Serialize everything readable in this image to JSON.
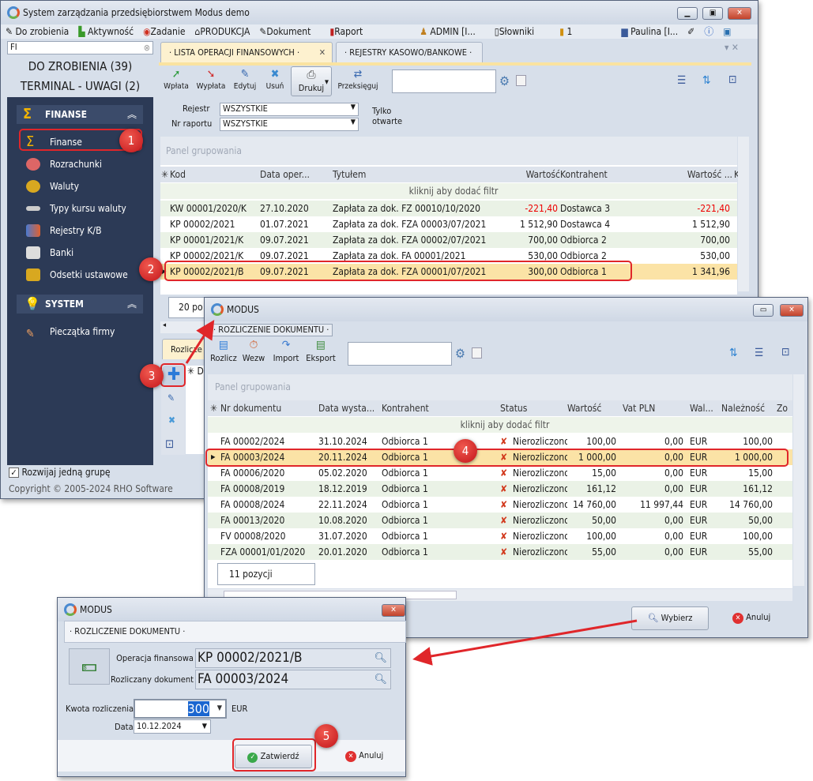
{
  "main_window": {
    "title": "System zarządzania przedsiębiorstwem Modus demo",
    "menu": [
      "Do zrobienia",
      "Aktywność",
      "Zadanie",
      "PRODUKCJA",
      "Dokument",
      "Raport",
      "ADMIN [I...",
      "Słowniki",
      "1",
      "Paulina [I..."
    ],
    "search_value": "FI",
    "counters": [
      "DO ZROBIENIA (39)",
      "TERMINAL - UWAGI (2)"
    ],
    "groups": [
      {
        "label": "FINANSE",
        "items": [
          "Finanse",
          "Rozrachunki",
          "Waluty",
          "Typy kursu waluty",
          "Rejestry K/B",
          "Banki",
          "Odsetki ustawowe"
        ]
      },
      {
        "label": "SYSTEM",
        "items": [
          "Pieczątka firmy"
        ]
      }
    ],
    "expand_one_group": "Rozwijaj jedną grupę",
    "expand_one_group_checked": true,
    "copyright": "Copyright © 2005-2024 RHO Software",
    "tabs": [
      "· LISTA OPERACJI FINANSOWYCH ·",
      "· REJESTRY KASOWO/BANKOWE ·"
    ],
    "toolbar": [
      "Wpłata",
      "Wypłata",
      "Edytuj",
      "Usuń",
      "Drukuj",
      "Przeksięguj"
    ],
    "filters": {
      "rejestr_label": "Rejestr",
      "rejestr_value": "WSZYSTKIE",
      "nr_raportu_label": "Nr raportu",
      "nr_raportu_value": "WSZYSTKIE",
      "only_open": "Tylko otwarte"
    },
    "group_panel": "Panel grupowania",
    "filter_hint": "kliknij aby dodać filtr",
    "columns": [
      "Kod",
      "Data oper...",
      "Tytułem",
      "Wartość",
      "Kontrahent",
      "Wartość ...",
      "K"
    ],
    "rows": [
      [
        "KW 00001/2020/K",
        "27.10.2020",
        "Zapłata za dok. FZ 00010/10/2020",
        "-221,40",
        "Dostawca 3",
        "-221,40"
      ],
      [
        "KP 00002/2021",
        "01.07.2021",
        "Zapłata za dok. FZA 00003/07/2021",
        "1 512,90",
        "Dostawca 4",
        "1 512,90"
      ],
      [
        "KP 00001/2021/K",
        "09.07.2021",
        "Zapłata za dok. FZA 00002/07/2021",
        "700,00",
        "Odbiorca 2",
        "700,00"
      ],
      [
        "KP 00002/2021/K",
        "09.07.2021",
        "Zapłata za dok. FA 00001/2021",
        "530,00",
        "Odbiorca 2",
        "530,00"
      ],
      [
        "KP 00002/2021/B",
        "09.07.2021",
        "Zapłata za dok. FZA 00001/07/2021",
        "300,00",
        "Odbiorca 1",
        "1 341,96"
      ]
    ],
    "count": "20 po",
    "lower_tab": "Rozlicze",
    "lower_col": "D"
  },
  "dialog_select": {
    "title": "MODUS",
    "tab": "· ROZLICZENIE DOKUMENTU ·",
    "toolbar": [
      "Rozlicz",
      "Wezw",
      "Import",
      "Eksport"
    ],
    "group_panel": "Panel grupowania",
    "filter_hint": "kliknij aby dodać filtr",
    "columns": [
      "Nr dokumentu",
      "Data wysta...",
      "Kontrahent",
      "Status",
      "Wartość",
      "Vat PLN",
      "Wal...",
      "Należność",
      "Zo"
    ],
    "rows": [
      [
        "FA 00002/2024",
        "31.10.2024",
        "Odbiorca 1",
        "Nierozliczono",
        "100,00",
        "0,00",
        "EUR",
        "100,00"
      ],
      [
        "FA 00003/2024",
        "20.11.2024",
        "Odbiorca 1",
        "Nierozliczono",
        "1 000,00",
        "0,00",
        "EUR",
        "1 000,00"
      ],
      [
        "FA 00006/2020",
        "05.02.2020",
        "Odbiorca 1",
        "Nierozliczono",
        "15,00",
        "0,00",
        "EUR",
        "15,00"
      ],
      [
        "FA 00008/2019",
        "18.12.2019",
        "Odbiorca 1",
        "Nierozliczono",
        "161,12",
        "0,00",
        "EUR",
        "161,12"
      ],
      [
        "FA 00008/2024",
        "22.11.2024",
        "Odbiorca 1",
        "Nierozliczono",
        "14 760,00",
        "11 997,44",
        "EUR",
        "14 760,00"
      ],
      [
        "FA 00013/2020",
        "10.08.2020",
        "Odbiorca 1",
        "Nierozliczono",
        "50,00",
        "0,00",
        "EUR",
        "50,00"
      ],
      [
        "FV 00008/2020",
        "31.07.2020",
        "Odbiorca 1",
        "Nierozliczono",
        "100,00",
        "0,00",
        "EUR",
        "100,00"
      ],
      [
        "FZA 00001/01/2020",
        "20.01.2020",
        "Odbiorca 1",
        "Nierozliczono",
        "55,00",
        "0,00",
        "EUR",
        "55,00"
      ]
    ],
    "count": "11 pozycji",
    "select_button": "Wybierz",
    "cancel_button": "Anuluj"
  },
  "dialog_settle": {
    "title": "MODUS",
    "tab": "· ROZLICZENIE DOKUMENTU ·",
    "op_label": "Operacja finansowa",
    "op_value": "KP 00002/2021/B",
    "doc_label": "Rozliczany dokument",
    "doc_value": "FA 00003/2024",
    "amount_label": "Kwota rozliczenia",
    "amount_value": "300",
    "currency": "EUR",
    "date_label": "Data",
    "date_value": "10.12.2024",
    "confirm_button": "Zatwierdź",
    "cancel_button": "Anuluj"
  },
  "steps": [
    "1",
    "2",
    "3",
    "4",
    "5"
  ],
  "colors": {
    "nav_bg": "#2c3a56",
    "selected_row": "#fbe3a6",
    "highlight": "#e0262a",
    "negative": "#e00000"
  }
}
